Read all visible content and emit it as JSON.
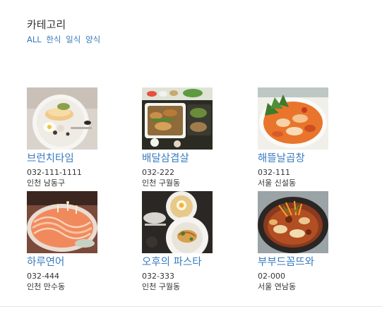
{
  "category": {
    "title": "카테고리",
    "links": [
      "ALL",
      "한식",
      "일식",
      "양식"
    ]
  },
  "restaurants": [
    {
      "name": "브런치타임",
      "phone": "032-111-1111",
      "address": "인천 남동구",
      "image": "brunch-plate-image"
    },
    {
      "name": "배달삼겹살",
      "phone": "032-222",
      "address": "인천 구월동",
      "image": "pork-belly-delivery-image"
    },
    {
      "name": "해뜰날곱창",
      "phone": "032-111",
      "address": "서울 신설동",
      "image": "gopchang-stirfry-image"
    },
    {
      "name": "하루연어",
      "phone": "032-444",
      "address": "인천 만수동",
      "image": "salmon-platter-image"
    },
    {
      "name": "오후의 파스타",
      "phone": "032-333",
      "address": "인천 구월동",
      "image": "pasta-plates-image"
    },
    {
      "name": "부부드꼼뜨와",
      "phone": "02-000",
      "address": "서울 연남동",
      "image": "stew-pot-image"
    }
  ],
  "colors": {
    "link": "#3a7bbf",
    "text": "#333333"
  }
}
